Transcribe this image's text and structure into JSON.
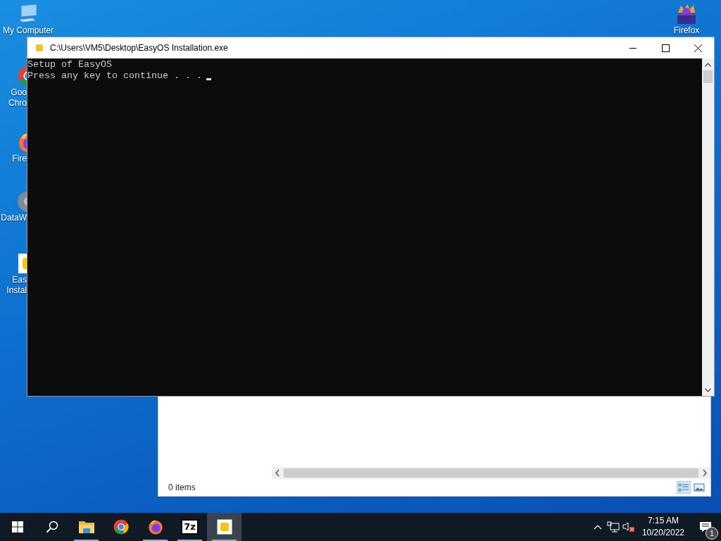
{
  "desktop_icons_left": [
    {
      "kind": "computer",
      "lines": [
        "My Computer"
      ]
    },
    {
      "kind": "chrome",
      "lines": [
        "Goo",
        "Chro"
      ]
    },
    {
      "kind": "firefox",
      "lines": [
        "Fire"
      ]
    },
    {
      "kind": "gear",
      "lines": [
        "DataW"
      ]
    },
    {
      "kind": "setup",
      "lines": [
        "Eas",
        "Instal"
      ]
    }
  ],
  "desktop_icons_right": [
    {
      "kind": "box",
      "lines": [
        "Firefox"
      ]
    }
  ],
  "console_window": {
    "title": "C:\\Users\\VM5\\Desktop\\EasyOS Installation.exe",
    "lines": [
      "Setup of EasyOS",
      "Press any key to continue . . ."
    ]
  },
  "explorer_window": {
    "status": "0 items"
  },
  "taskbar": {
    "apps": [
      {
        "kind": "start",
        "selected": false,
        "running": false
      },
      {
        "kind": "search",
        "selected": false,
        "running": false
      },
      {
        "kind": "folder",
        "selected": false,
        "running": true
      },
      {
        "kind": "chrome",
        "selected": false,
        "running": false
      },
      {
        "kind": "firefox",
        "selected": false,
        "running": true
      },
      {
        "kind": "archiver",
        "selected": false,
        "running": true,
        "label": "7z"
      },
      {
        "kind": "setup",
        "selected": true,
        "running": true
      }
    ],
    "clock": {
      "time": "7:15 AM",
      "date": "10/20/2022"
    },
    "notification_count": "1"
  }
}
